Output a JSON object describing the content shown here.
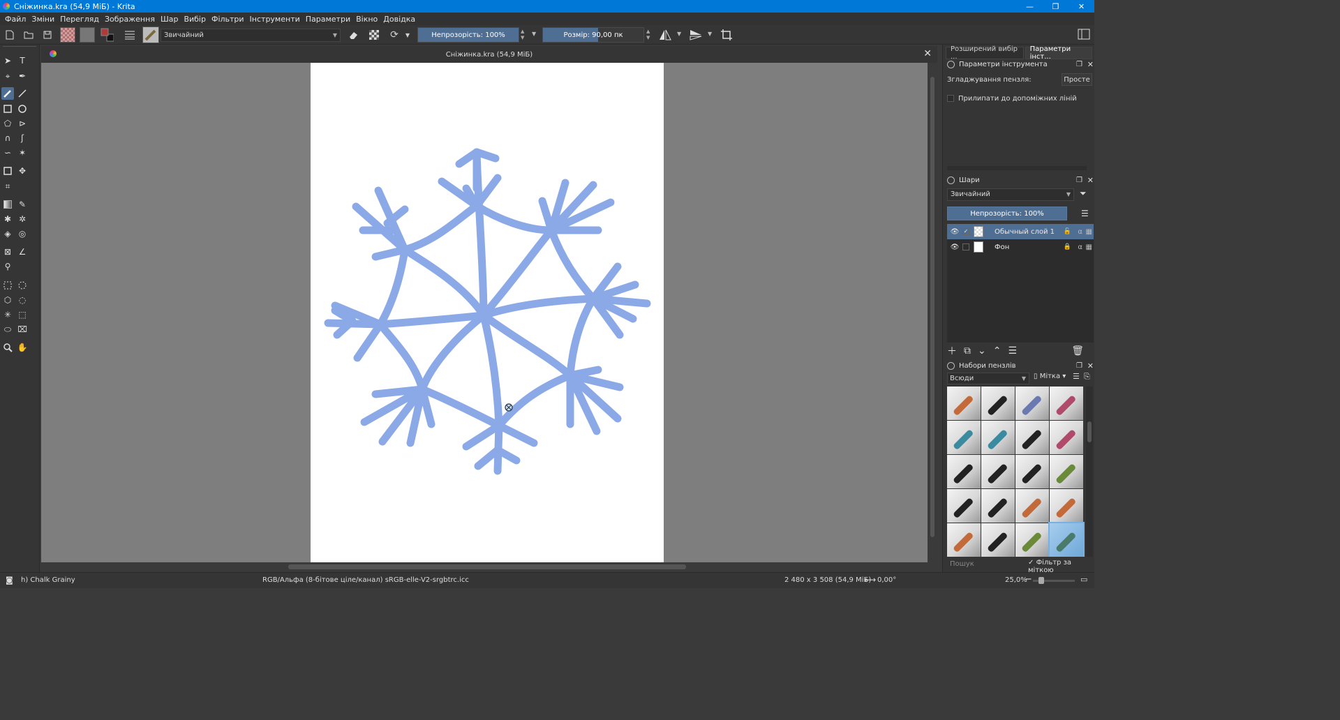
{
  "window": {
    "title": "Сніжинка.kra (54,9 МіБ)  - Krita",
    "min": "—",
    "restore": "❐",
    "close": "✕"
  },
  "menu": [
    "Файл",
    "Зміни",
    "Перегляд",
    "Зображення",
    "Шар",
    "Вибір",
    "Фільтри",
    "Інструменти",
    "Параметри",
    "Вікно",
    "Довідка"
  ],
  "toolbar": {
    "blend_mode": "Звичайний",
    "opacity_label": "Непрозорість: 100%",
    "opacity_value": 1.0,
    "size_label": "Розмір: 90,00 пк",
    "size_fill_percent": 55
  },
  "document": {
    "tab_title": "Сніжинка.kra (54,9 МіБ)",
    "close": "✕",
    "stroke_color": "#8aa9e6"
  },
  "tool_options": {
    "tab_1": "Розширений вибір ...",
    "tab_2": "Параметри інст...",
    "title": "Параметри інструмента",
    "smoothing_label": "Згладжування пензля:",
    "smoothing_value": "Просте",
    "snap_label": "Прилипати до допоміжних ліній"
  },
  "layers": {
    "title": "Шари",
    "blend_mode": "Звичайний",
    "opacity_label": "Непрозорість:  100%",
    "items": [
      {
        "name": "Обычный слой 1",
        "selected": true
      },
      {
        "name": "Фон",
        "selected": false
      }
    ]
  },
  "brush_presets": {
    "title": "Набори пензлів",
    "filter": "Всюди",
    "tag": "Мітка",
    "search_placeholder": "Пошук",
    "filter_by_tag": "Фільтр за міткою"
  },
  "status": {
    "brush_name": "h) Chalk Grainy",
    "color_space": "RGB/Альфа (8-бітове ціле/канал)  sRGB-elle-V2-srgbtrc.icc",
    "doc_size": "2 480 x 3 508 (54,9 МіБ)",
    "rotation": "0,00°",
    "zoom": "25,0%"
  }
}
